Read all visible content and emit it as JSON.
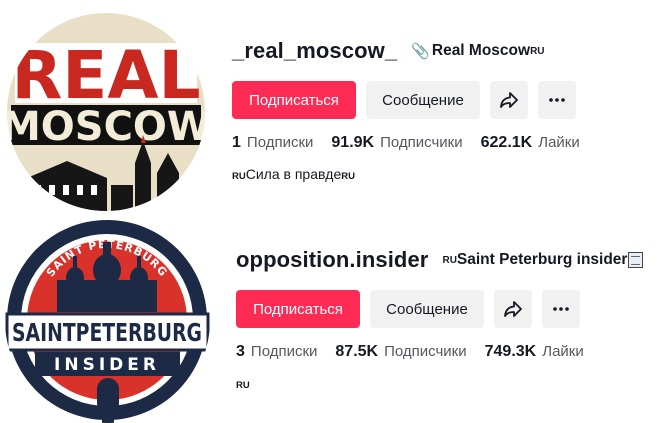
{
  "buttons": {
    "follow_label": "Подписаться",
    "message_label": "Сообщение",
    "share_icon": "share-icon",
    "more_icon": "more-icon"
  },
  "stat_labels": {
    "following": "Подписки",
    "followers": "Подписчики",
    "likes": "Лайки"
  },
  "colors": {
    "follow_button": "#fe2c55",
    "secondary_button": "#f1f1f2"
  },
  "profiles": [
    {
      "username": "_real_moscow_",
      "nickname_icon": "paperclip-icon",
      "nickname": "Real Moscow",
      "nickname_suffix": "RU",
      "following": "1",
      "followers": "91.9K",
      "likes": "622.1K",
      "bio_prefix": "RU",
      "bio_text": "Сила в правде",
      "bio_suffix": "RU",
      "avatar_text": [
        "REAL",
        "MOSCOW"
      ]
    },
    {
      "username": "opposition.insider",
      "nickname_prefix": "RU",
      "nickname": "Saint Peterburg insider",
      "nickname_icon": "newspaper-icon",
      "following": "3",
      "followers": "87.5K",
      "likes": "749.3K",
      "bio_prefix": "RU",
      "avatar_text": [
        "SAINT PETERBURG",
        "SAINTPETERBURG",
        "INSIDER"
      ]
    }
  ]
}
